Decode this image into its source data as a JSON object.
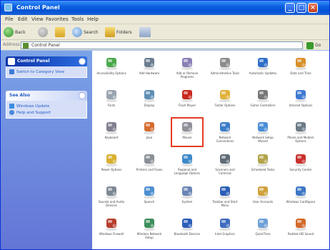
{
  "window": {
    "title": "Control Panel"
  },
  "menu": [
    "File",
    "Edit",
    "View",
    "Favorites",
    "Tools",
    "Help"
  ],
  "toolbar": {
    "back": "Back",
    "search": "Search",
    "folders": "Folders"
  },
  "address": {
    "label": "Address",
    "value": "Control Panel",
    "go": "Go"
  },
  "sidebar": {
    "control_panel": {
      "title": "Control Panel",
      "tasks": [
        "Switch to Category View"
      ]
    },
    "see_also": {
      "title": "See Also",
      "tasks": [
        "Windows Update",
        "Help and Support"
      ]
    }
  },
  "applets": [
    {
      "name": "Accessibility Options",
      "icon": "accessibility-icon",
      "color": "#4aa84a"
    },
    {
      "name": "Add Hardware",
      "icon": "add-hardware-icon",
      "color": "#6b7d8f"
    },
    {
      "name": "Add or Remove Programs",
      "icon": "add-remove-programs-icon",
      "color": "#8a7fb5"
    },
    {
      "name": "Administrative Tools",
      "icon": "administrative-tools-icon",
      "color": "#8c8c8c"
    },
    {
      "name": "Automatic Updates",
      "icon": "automatic-updates-icon",
      "color": "#2f6fc9"
    },
    {
      "name": "Date and Time",
      "icon": "date-time-icon",
      "color": "#d88f2a"
    },
    {
      "name": "Fonts",
      "icon": "fonts-icon",
      "color": "#9aa3b0"
    },
    {
      "name": "Display",
      "icon": "display-icon",
      "color": "#5f8fb5"
    },
    {
      "name": "Flash Player",
      "icon": "flash-player-icon",
      "color": "#c8281f"
    },
    {
      "name": "Folder Options",
      "icon": "folder-options-icon",
      "color": "#e0b23a"
    },
    {
      "name": "Game Controllers",
      "icon": "game-controllers-icon",
      "color": "#777777"
    },
    {
      "name": "Internet Options",
      "icon": "internet-options-icon",
      "color": "#3f7ad2"
    },
    {
      "name": "Keyboard",
      "icon": "keyboard-icon",
      "color": "#7f7f8f"
    },
    {
      "name": "Java",
      "icon": "java-icon",
      "color": "#d56b2e"
    },
    {
      "name": "Mouse",
      "icon": "mouse-icon",
      "color": "#8f9099"
    },
    {
      "name": "Network Connections",
      "icon": "network-connections-icon",
      "color": "#3a7cc8"
    },
    {
      "name": "Network Setup Wizard",
      "icon": "network-setup-wizard-icon",
      "color": "#4b8ed8"
    },
    {
      "name": "Phone and Modem Options",
      "icon": "phone-modem-icon",
      "color": "#6c7a88"
    },
    {
      "name": "Power Options",
      "icon": "power-options-icon",
      "color": "#d9b030"
    },
    {
      "name": "Printers and Faxes",
      "icon": "printers-faxes-icon",
      "color": "#8a8f96"
    },
    {
      "name": "Regional and Language Options",
      "icon": "regional-language-icon",
      "color": "#3d88c9"
    },
    {
      "name": "Scanners and Cameras",
      "icon": "scanners-cameras-icon",
      "color": "#5f6a76"
    },
    {
      "name": "Scheduled Tasks",
      "icon": "scheduled-tasks-icon",
      "color": "#b3a34a"
    },
    {
      "name": "Security Center",
      "icon": "security-center-icon",
      "color": "#c9302c"
    },
    {
      "name": "Sounds and Audio Devices",
      "icon": "sounds-audio-icon",
      "color": "#7d8893"
    },
    {
      "name": "Speech",
      "icon": "speech-icon",
      "color": "#4d8fd0"
    },
    {
      "name": "System",
      "icon": "system-icon",
      "color": "#6a86b4"
    },
    {
      "name": "Taskbar and Start Menu",
      "icon": "taskbar-start-menu-icon",
      "color": "#2b5fb7"
    },
    {
      "name": "User Accounts",
      "icon": "user-accounts-icon",
      "color": "#d0a23c"
    },
    {
      "name": "Windows CardSpace",
      "icon": "cardspace-icon",
      "color": "#3d77c6"
    },
    {
      "name": "Windows Firewall",
      "icon": "windows-firewall-icon",
      "color": "#b73d2c"
    },
    {
      "name": "Wireless Network Setup",
      "icon": "wireless-network-icon",
      "color": "#3c8f5a"
    },
    {
      "name": "Bluetooth Devices",
      "icon": "bluetooth-icon",
      "color": "#2d5eb8"
    },
    {
      "name": "Intel Graphics",
      "icon": "intel-graphics-icon",
      "color": "#3d6cc0"
    },
    {
      "name": "QuickTime",
      "icon": "quicktime-icon",
      "color": "#6fa1d6"
    },
    {
      "name": "Realtek HD Sound",
      "icon": "realtek-sound-icon",
      "color": "#d36b2a"
    }
  ],
  "selected_applet": "Mouse"
}
